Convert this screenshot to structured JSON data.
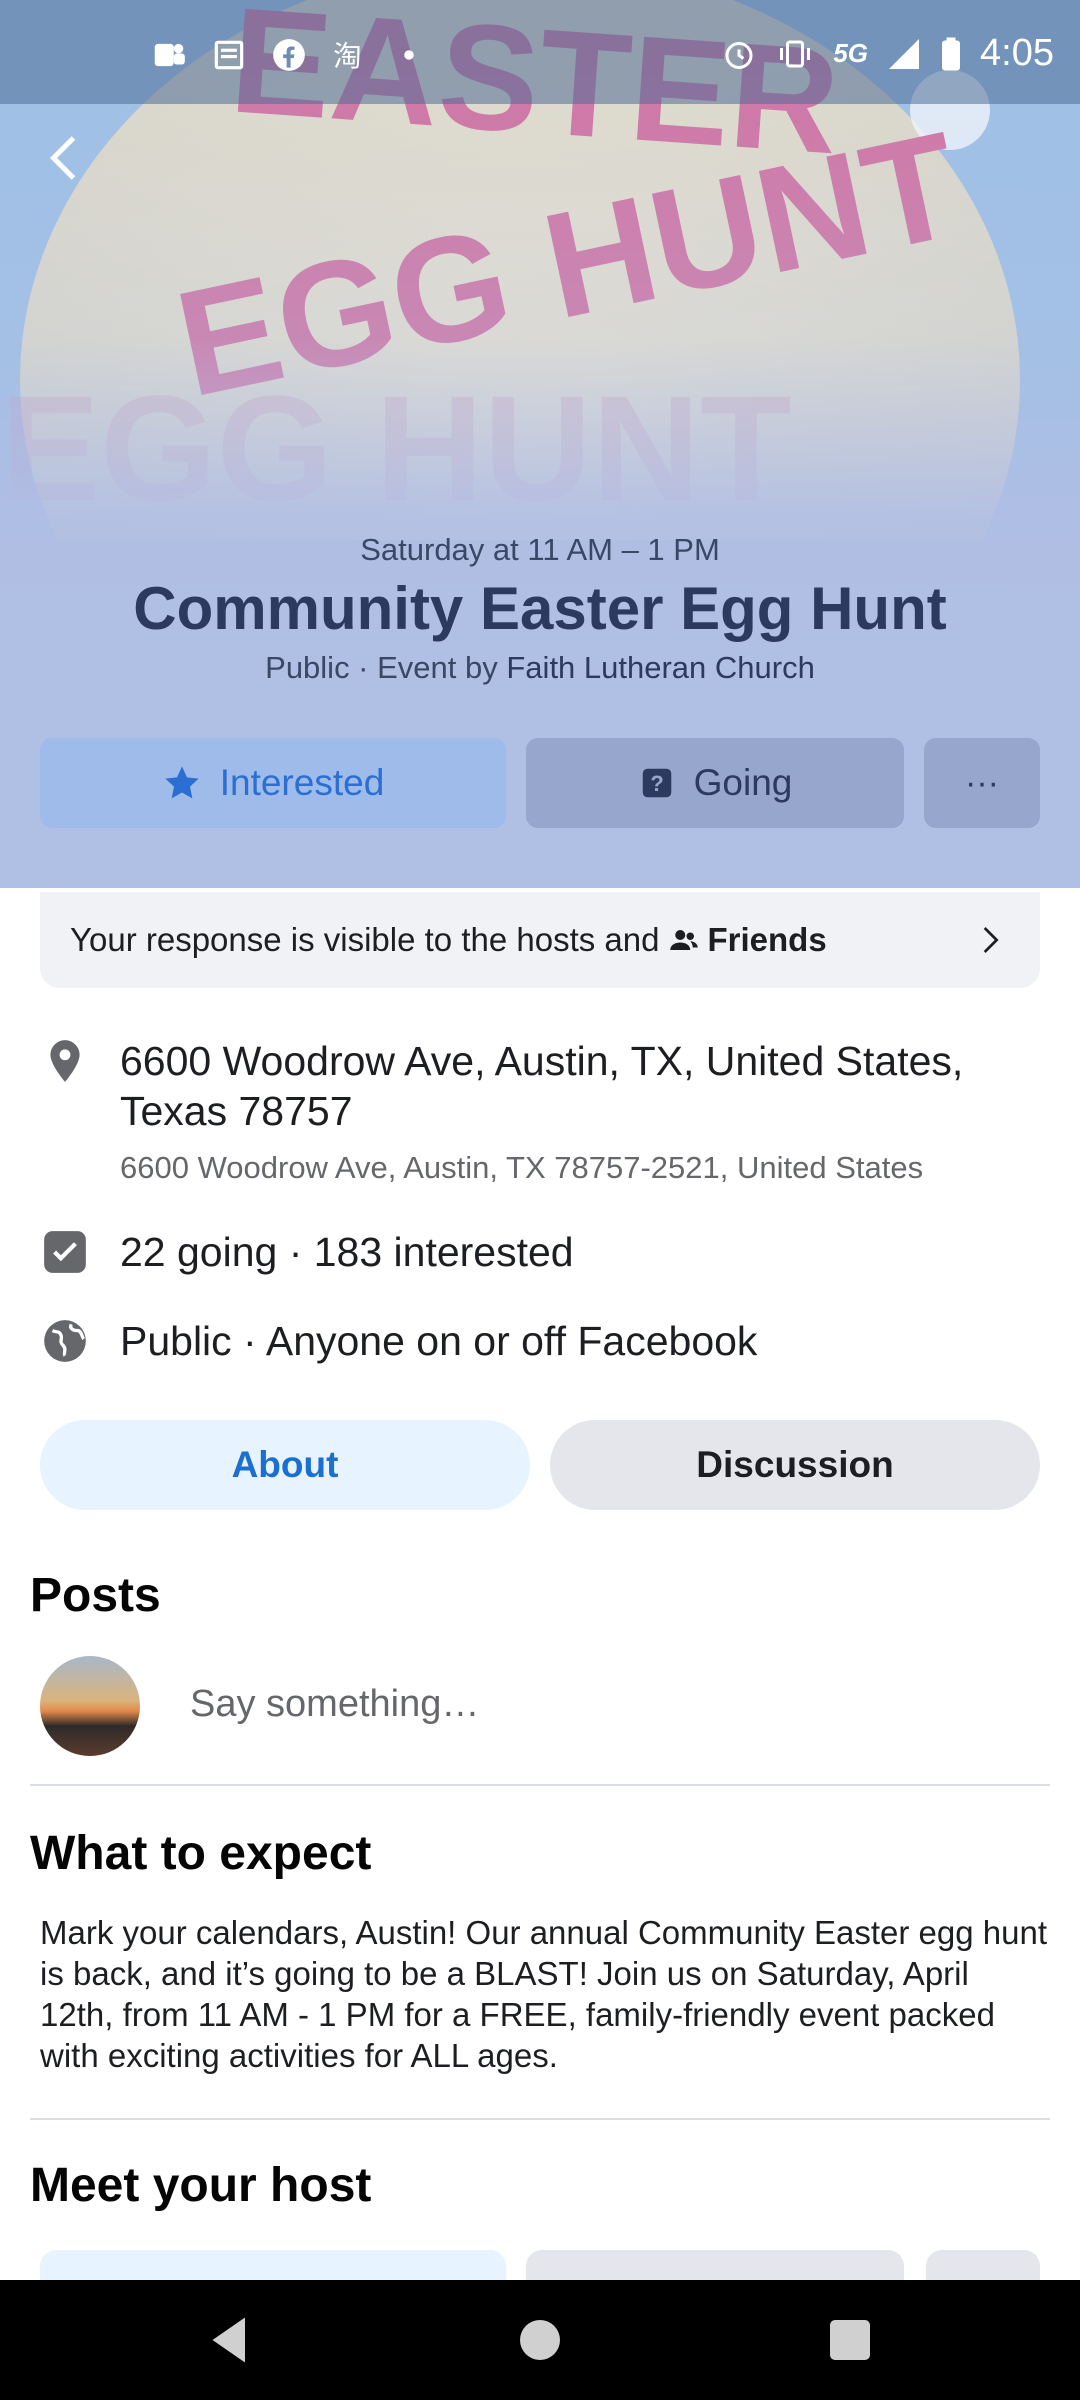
{
  "status_bar": {
    "time": "4:05",
    "network": "5G",
    "left_icons": [
      "teams-icon",
      "news-icon",
      "facebook-icon",
      "taobao-icon",
      "dot-icon"
    ],
    "right_icons": [
      "alarm-icon",
      "vibrate-icon",
      "signal-icon",
      "battery-icon"
    ]
  },
  "hero": {
    "image_banner_text": "EASTER EGG HUNT",
    "date": "Saturday at 11 AM – 1 PM",
    "title": "Community Easter Egg Hunt",
    "privacy": "Public · Event by",
    "host": "Faith Lutheran Church",
    "buttons": {
      "interested": "Interested",
      "going": "Going",
      "more": "···"
    }
  },
  "response": {
    "text": "Your response is visible to the hosts and",
    "audience": "Friends"
  },
  "details": {
    "address_main": "6600 Woodrow Ave, Austin, TX, United States, Texas 78757",
    "address_sub": "6600 Woodrow Ave, Austin, TX 78757-2521, United States",
    "attendance": "22 going · 183 interested",
    "visibility": "Public · Anyone on or off Facebook"
  },
  "tabs": {
    "about": "About",
    "discussion": "Discussion"
  },
  "posts": {
    "title": "Posts",
    "compose_placeholder": "Say something…"
  },
  "expect": {
    "title": "What to expect",
    "body": "Mark your calendars, Austin! Our annual Community Easter egg hunt is back, and it’s going to be a BLAST! Join us on Saturday, April 12th, from 11 AM - 1 PM for a FREE, family-friendly event packed with exciting activities for ALL ages."
  },
  "host_section": {
    "title": "Meet your host"
  },
  "colors": {
    "accent": "#1b6fd1",
    "hero_bg": "#b0bfe4",
    "tab_active_bg": "#e7f3ff",
    "tab_inactive_bg": "#e4e6eb"
  }
}
